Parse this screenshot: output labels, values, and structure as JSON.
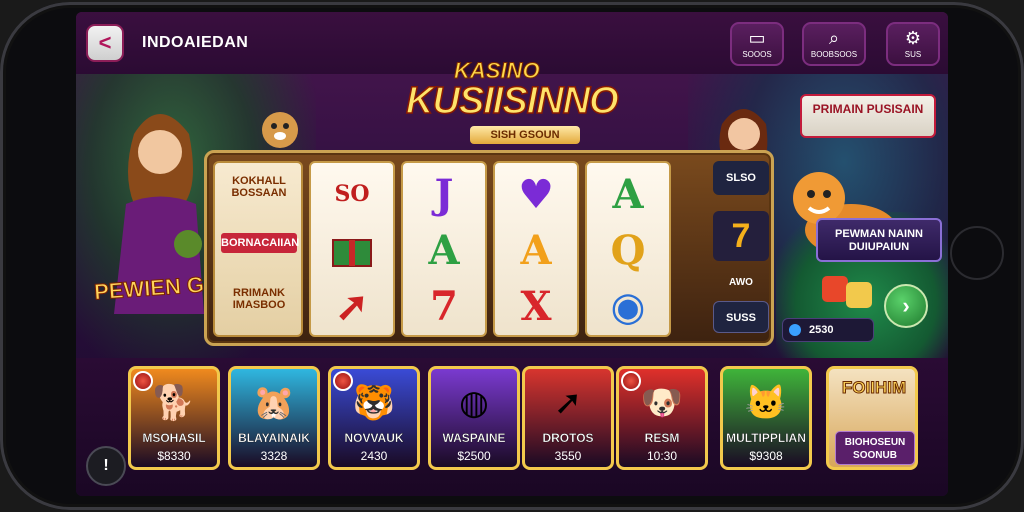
{
  "app": {
    "title": "INDOAIEDAN"
  },
  "toolbar": [
    {
      "icon": "screen-icon",
      "glyph": "▭",
      "label": "SOOOS"
    },
    {
      "icon": "search-icon",
      "glyph": "⌕",
      "label": "BOOBSOOS"
    },
    {
      "icon": "gear-icon",
      "glyph": "⚙",
      "label": "SUS"
    }
  ],
  "logo": {
    "line1": "KASINO",
    "line2": "KUSIISINNO",
    "tag": "SISH GSOUN"
  },
  "promos": {
    "left": "PEWIEN GUSIINO",
    "right_top": "PRIMAIN PUSISAIN",
    "right_mid": "PEWMAN NAINN DUIUPAIUN"
  },
  "side_panel": {
    "a": "KOKHALL BOSSAAN",
    "b": "BORNACAIIAN",
    "c": "RRIMANK IMASBOO"
  },
  "reels": [
    [
      "SO",
      "",
      ""
    ],
    [
      "J",
      "A",
      "7"
    ],
    [
      "",
      "A",
      "X"
    ],
    [
      "A",
      "Q",
      ""
    ]
  ],
  "right_column": {
    "top": "SLSO",
    "mid": "7",
    "label": "AWO",
    "bottom": "SUSS"
  },
  "info_pill": "2530",
  "games": [
    {
      "name": "MSOHASIL",
      "amount": "$8330",
      "color": "#f08a1e"
    },
    {
      "name": "BLAYAINAIK",
      "amount": "3328",
      "color": "#2fb7e0"
    },
    {
      "name": "NOVVAUK",
      "amount": "2430",
      "color": "#3a4bd6"
    },
    {
      "name": "WASPAINE",
      "amount": "$2500",
      "color": "#7a3ad0"
    },
    {
      "name": "DROTOS",
      "amount": "3550",
      "color": "#d8352e"
    },
    {
      "name": "RESM",
      "amount": "10:30",
      "color": "#e0302a"
    },
    {
      "name": "MULTIPPLIAN",
      "amount": "$9308",
      "color": "#3fb43a"
    }
  ],
  "last_tile": {
    "title": "FOIIHIM",
    "sub": "BIOHOSEUN SOONUB"
  }
}
